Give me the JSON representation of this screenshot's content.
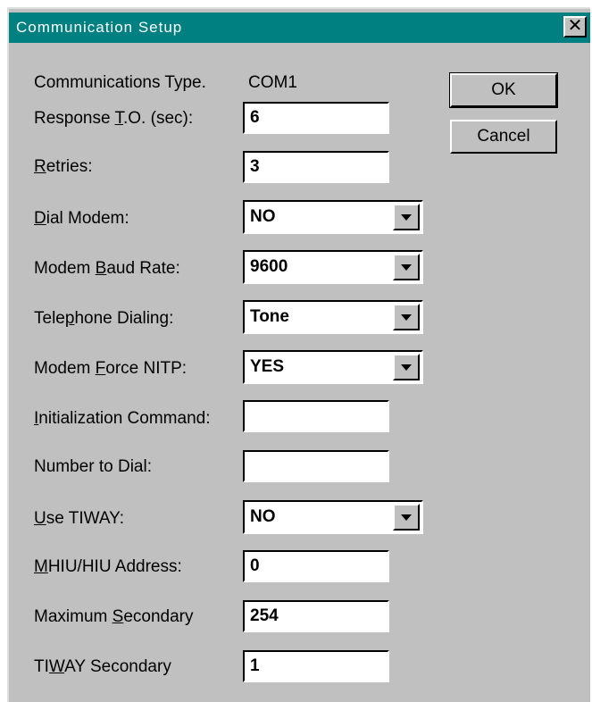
{
  "window": {
    "title": "Communication Setup",
    "close_glyph": "✕"
  },
  "buttons": {
    "ok": "OK",
    "cancel": "Cancel"
  },
  "fields": {
    "comm_type": {
      "label": "Communications Type.",
      "value": "COM1"
    },
    "response_to": {
      "label_pre": "Response ",
      "label_key": "T",
      "label_post": ".O. (sec):",
      "value": "6"
    },
    "retries": {
      "label_pre": "",
      "label_key": "R",
      "label_post": "etries:",
      "value": "3"
    },
    "dial_modem": {
      "label_pre": "",
      "label_key": "D",
      "label_post": "ial Modem:",
      "value": "NO"
    },
    "baud_rate": {
      "label_pre": "Modem ",
      "label_key": "B",
      "label_post": "aud Rate:",
      "value": "9600"
    },
    "telephone_dialing": {
      "label_pre": "Tele",
      "label_key": "p",
      "label_post": "hone Dialing:",
      "value": "Tone"
    },
    "force_nitp": {
      "label_pre": "Modem ",
      "label_key": "F",
      "label_post": "orce NITP:",
      "value": "YES"
    },
    "init_command": {
      "label_pre": "",
      "label_key": "I",
      "label_post": "nitialization Command:",
      "value": ""
    },
    "number_to_dial": {
      "label": "Number to Dial:",
      "value": ""
    },
    "use_tiway": {
      "label_pre": "",
      "label_key": "U",
      "label_post": "se TIWAY:",
      "value": "NO"
    },
    "mhiu_address": {
      "label_pre": "",
      "label_key": "M",
      "label_post": "HIU/HIU Address:",
      "value": "0"
    },
    "max_secondary": {
      "label_pre": "Maximum ",
      "label_key": "S",
      "label_post": "econdary",
      "value": "254"
    },
    "tiway_secondary": {
      "label_pre": "TI",
      "label_key": "W",
      "label_post": "AY Secondary",
      "value": "1"
    }
  },
  "icons": {
    "dropdown": "chevron-down-icon",
    "close": "close-icon"
  }
}
